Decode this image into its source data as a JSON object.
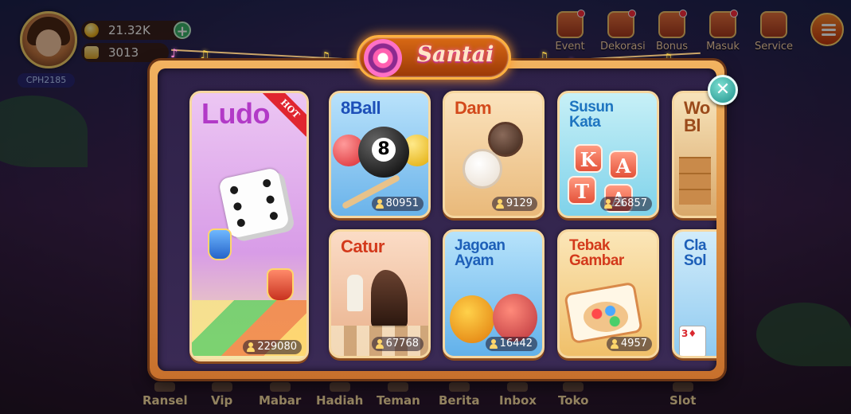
{
  "profile": {
    "player_id": "CPH2185",
    "coins": "21.32K",
    "tickets": "3013"
  },
  "top_nav": [
    {
      "label": "Event",
      "icon": "gift-icon"
    },
    {
      "label": "Dekorasi",
      "icon": "decoration-icon"
    },
    {
      "label": "Bonus",
      "icon": "bonus-icon"
    },
    {
      "label": "Masuk",
      "icon": "login-calendar-icon"
    },
    {
      "label": "Service",
      "icon": "headset-icon"
    }
  ],
  "bottom_nav": [
    {
      "label": "Ransel"
    },
    {
      "label": "Vip"
    },
    {
      "label": "Mabar"
    },
    {
      "label": "Hadiah"
    },
    {
      "label": "Teman"
    },
    {
      "label": "Berita"
    },
    {
      "label": "Inbox"
    },
    {
      "label": "Toko"
    },
    {
      "label": "Slot"
    }
  ],
  "modal": {
    "title": "Santai",
    "close_icon": "close-icon"
  },
  "games": [
    {
      "title": "Ludo",
      "players": "229080",
      "badge": "HOT",
      "bg": "#e6b8ef"
    },
    {
      "title": "8Ball",
      "players": "80951",
      "bg": "#9ed3f5"
    },
    {
      "title": "Dam",
      "players": "9129",
      "bg": "#f7dcae"
    },
    {
      "title": "Susun\nKata",
      "players": "26857",
      "bg": "#a9e6f2",
      "tiles": [
        "K",
        "A",
        "T",
        "A"
      ]
    },
    {
      "title": "Wo\nBl",
      "players": "",
      "bg": "#f3d9a8"
    },
    {
      "title": "Catur",
      "players": "67768",
      "bg": "#f6d2b8"
    },
    {
      "title": "Jagoan\nAyam",
      "players": "16442",
      "bg": "#9fd6f5"
    },
    {
      "title": "Tebak\nGambar",
      "players": "4957",
      "bg": "#f9dfa8"
    },
    {
      "title": "Cla\nSol",
      "players": "",
      "bg": "#b8e1f5"
    }
  ],
  "colors": {
    "modal_frame": "#e49a4a",
    "title_glow": "#ff9a2a",
    "close_button": "#1f8f8a",
    "hot_ribbon": "#e0252f"
  }
}
